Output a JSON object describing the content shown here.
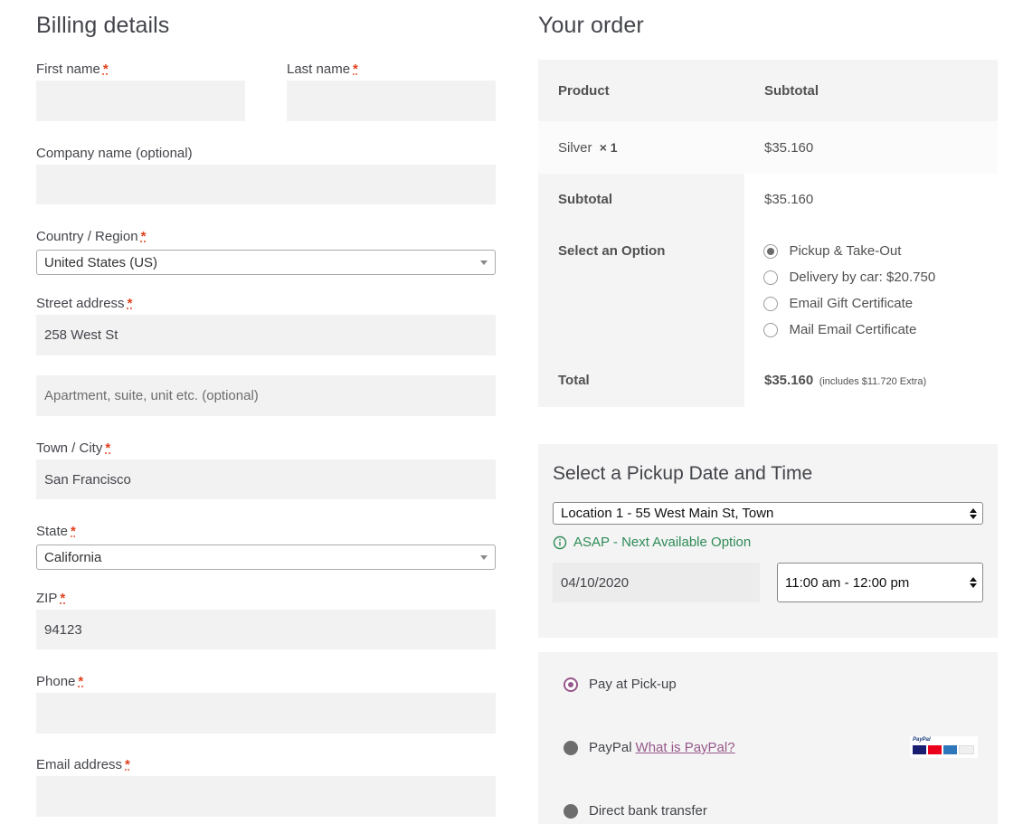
{
  "billing": {
    "title": "Billing details",
    "required_mark": "*",
    "first_name": {
      "label": "First name",
      "value": ""
    },
    "last_name": {
      "label": "Last name",
      "value": ""
    },
    "company": {
      "label": "Company name (optional)",
      "value": ""
    },
    "country": {
      "label": "Country / Region",
      "value": "United States (US)"
    },
    "street": {
      "label": "Street address",
      "value": "258 West St",
      "placeholder2": "Apartment, suite, unit etc. (optional)"
    },
    "city": {
      "label": "Town / City",
      "value": "San Francisco"
    },
    "state": {
      "label": "State",
      "value": "California"
    },
    "zip": {
      "label": "ZIP",
      "value": "94123"
    },
    "phone": {
      "label": "Phone",
      "value": ""
    },
    "email": {
      "label": "Email address",
      "value": ""
    }
  },
  "order": {
    "title": "Your order",
    "col_product": "Product",
    "col_subtotal": "Subtotal",
    "item_name": "Silver",
    "item_qty": "× 1",
    "item_price": "$35.160",
    "subtotal_label": "Subtotal",
    "subtotal_value": "$35.160",
    "option_label": "Select an Option",
    "options": [
      {
        "label": "Pickup & Take-Out",
        "checked": true
      },
      {
        "label": "Delivery by car: $20.750",
        "checked": false
      },
      {
        "label": "Email Gift Certificate",
        "checked": false
      },
      {
        "label": "Mail Email Certificate",
        "checked": false
      }
    ],
    "total_label": "Total",
    "total_value": "$35.160",
    "total_note": "(includes $11.720 Extra)"
  },
  "pickup": {
    "title": "Select a Pickup Date and Time",
    "location": "Location 1 - 55 West Main St, Town",
    "asap": "ASAP - Next Available Option",
    "date": "04/10/2020",
    "time": "11:00 am - 12:00 pm"
  },
  "payment": {
    "methods": [
      {
        "label": "Pay at Pick-up",
        "selected": true
      },
      {
        "label": "PayPal",
        "link": "What is PayPal?",
        "selected": false
      },
      {
        "label": "Direct bank transfer",
        "selected": false
      }
    ],
    "paypal_logo_text": "PayPal",
    "accent": "#96588a"
  },
  "colors": {
    "required": "#e2401c",
    "asap": "#2e8b57",
    "field_bg": "#f2f2f2",
    "panel_bg": "#f8f8f8"
  }
}
